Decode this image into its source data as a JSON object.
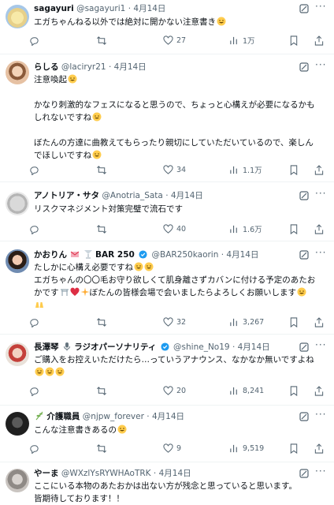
{
  "posts": [
    {
      "name": "sagayuri",
      "handle": "@sagayuri1",
      "dot": "·",
      "date": "4月14日",
      "lines": [
        "エガちゃんねる以外では絶対に開かない注意書き"
      ],
      "replies": "",
      "retweets": "",
      "likes": "27",
      "views": "1万"
    },
    {
      "name": "らしる",
      "handle": "@laciryr21",
      "dot": "·",
      "date": "4月14日",
      "lines": [
        "注意喚起",
        "",
        "かなり刺激的なフェスになると思うので、ちょっと心構えが必要になるかも",
        "しれないですね",
        "",
        "ぼたんの方達に曲教えてもらったり親切にしていただいているので、楽しん",
        "でほしいですね"
      ],
      "replies": "",
      "retweets": "",
      "likes": "34",
      "views": "1.1万"
    },
    {
      "name": "アノトリア・サタ",
      "handle": "@Anotria_Sata",
      "dot": "·",
      "date": "4月14日",
      "lines": [
        "リスクマネジメント対策完璧で流石です"
      ],
      "replies": "",
      "retweets": "",
      "likes": "40",
      "views": "1.6万"
    },
    {
      "name": "かおりん",
      "name_suffix": "BAR 250",
      "handle": "@BAR250kaorin",
      "dot": "·",
      "date": "4月14日",
      "lines": [
        "たしかに心構え必要ですね",
        "エガちゃんの〇〇毛お守り欲しくて肌身離さずカバンに付ける予定のあたお",
        "かです",
        "ぼたんの皆様会場で会いましたらよろしくお願いします"
      ],
      "replies": "",
      "retweets": "",
      "likes": "32",
      "views": "3,267"
    },
    {
      "name": "長澤琴",
      "name_suffix": "ラジオパーソナリティ",
      "handle": "@shine_No19",
      "dot": "·",
      "date": "4月14日",
      "lines": [
        "ご購入をお控えいただけたら…っていうアナウンス、なかなか無いですよね"
      ],
      "replies": "",
      "retweets": "",
      "likes": "20",
      "views": "8,241"
    },
    {
      "name": "介護職員",
      "handle": "@njpw_forever",
      "dot": "·",
      "date": "4月14日",
      "lines": [
        "こんな注意書きあるの"
      ],
      "replies": "",
      "retweets": "",
      "likes": "9",
      "views": "9,519"
    },
    {
      "name": "やーま",
      "handle": "@WXzlYsRYWHAoTRK",
      "dot": "·",
      "date": "4月14日",
      "lines": [
        "ここにいる本物のあたおかは出ない方が残念と思っていると思います。",
        "皆期待しております！！"
      ]
    }
  ],
  "icons": {
    "grok": "grok-icon",
    "more": "more-icon",
    "reply": "reply-icon",
    "retweet": "retweet-icon",
    "like": "heart-icon",
    "views": "views-icon",
    "bookmark": "bookmark-icon",
    "share": "share-icon",
    "verified": "verified-badge-icon"
  },
  "colors": {
    "text": "#0f1419",
    "muted": "#536471",
    "divider": "#eff3f4",
    "verified": "#1d9bf0"
  }
}
